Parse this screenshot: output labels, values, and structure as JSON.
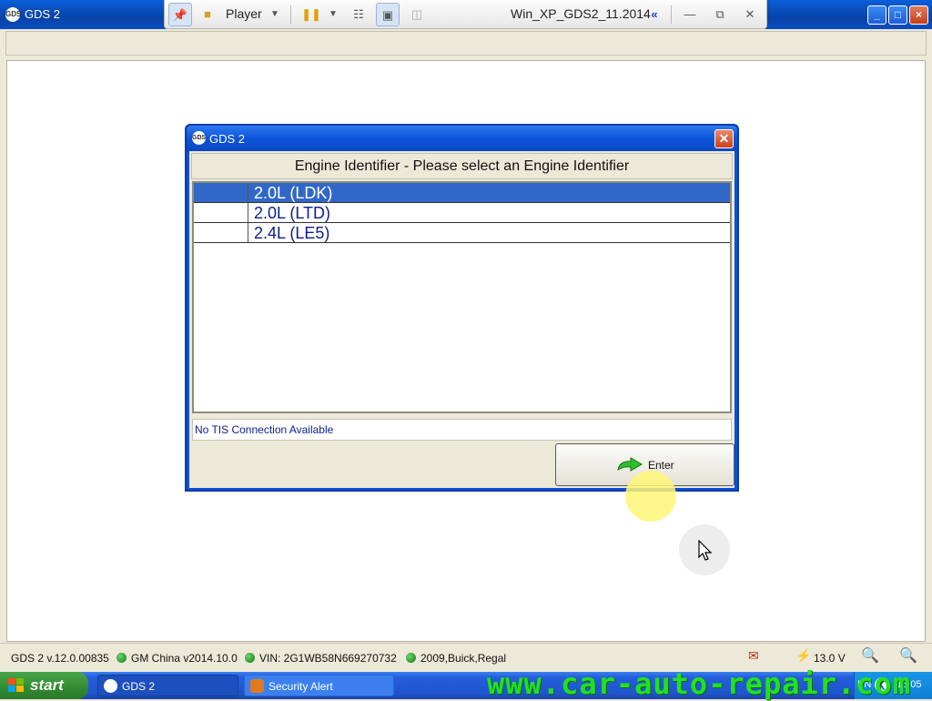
{
  "window": {
    "title": "GDS 2",
    "icon": "gds-icon"
  },
  "player": {
    "label": "Player",
    "vm_name": "Win_XP_GDS2_11.2014"
  },
  "dialog": {
    "title": "GDS 2",
    "header": "Engine Identifier - Please select an Engine Identifier",
    "items": [
      {
        "label": "2.0L (LDK)",
        "selected": true
      },
      {
        "label": "2.0L (LTD)",
        "selected": false
      },
      {
        "label": "2.4L (LE5)",
        "selected": false
      }
    ],
    "status": "No TIS Connection Available",
    "enter_label": "Enter"
  },
  "status_bar": {
    "version": "GDS 2 v.12.0.00835",
    "region": "GM China v2014.10.0",
    "vin": "VIN: 2G1WB58N669270732",
    "vehicle": "2009,Buick,Regal",
    "voltage": "13.0 V"
  },
  "taskbar": {
    "start": "start",
    "items": [
      {
        "label": "GDS 2"
      },
      {
        "label": "Security Alert"
      }
    ],
    "lang": "EN",
    "clock": "15:05"
  },
  "watermark": "www.car-auto-repair.com",
  "colors": {
    "selection": "#3168c8",
    "list_text": "#0c1e8c",
    "status_dot": "#0c7d0c",
    "watermark": "#22e022"
  }
}
